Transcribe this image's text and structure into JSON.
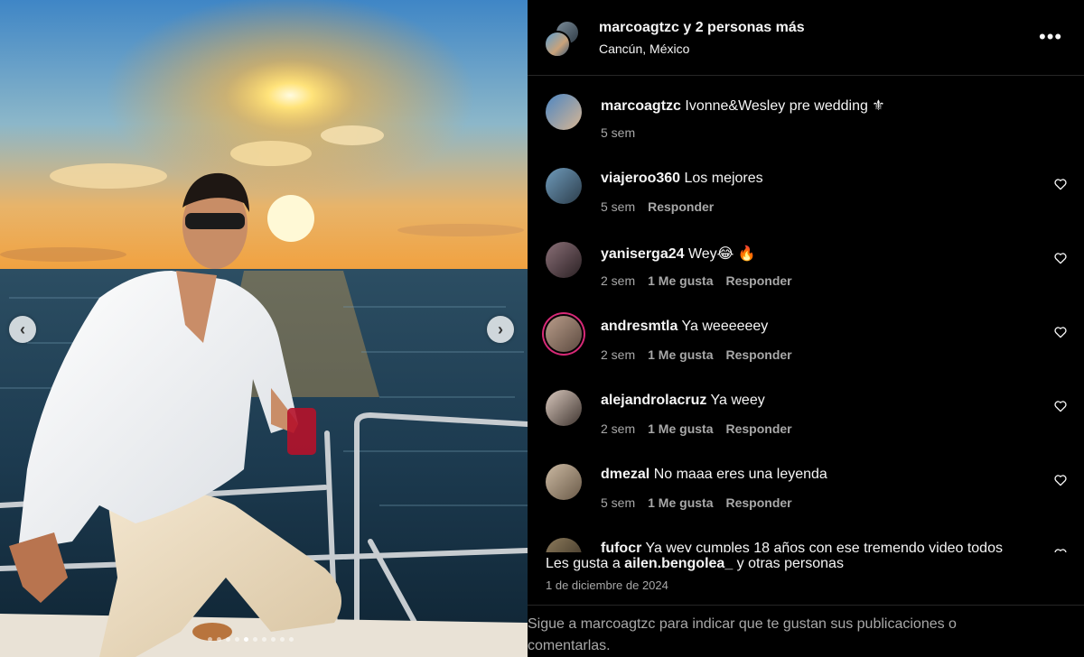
{
  "media": {
    "prev_icon": "chevron-left-icon",
    "next_icon": "chevron-right-icon",
    "prev_glyph": "‹",
    "next_glyph": "›",
    "dot_count": 10,
    "active_dot_index": 4
  },
  "header": {
    "title": "marcoagtzc y 2 personas más",
    "location": "Cancún, México",
    "more_glyph": "•••",
    "more_icon": "more-options-icon"
  },
  "comments": [
    {
      "user": "marcoagtzc",
      "text": " Ivonne&Wesley pre wedding ⚜",
      "time": "5 sem",
      "likes": "",
      "reply": "",
      "avatar_colors": [
        "#4d86c2",
        "#d8b693"
      ],
      "ring": false,
      "heart": false
    },
    {
      "user": "viajeroo360",
      "text": " Los mejores",
      "time": "5 sem",
      "likes": "",
      "reply": "Responder",
      "avatar_colors": [
        "#6f9bbb",
        "#2c3d4b"
      ],
      "ring": false,
      "heart": true
    },
    {
      "user": "yaniserga24",
      "text": " Wey😂 🔥",
      "time": "2 sem",
      "likes": "1 Me gusta",
      "reply": "Responder",
      "avatar_colors": [
        "#8a6f77",
        "#2b2124"
      ],
      "ring": false,
      "heart": true
    },
    {
      "user": "andresmtla",
      "text": " Ya weeeeeey",
      "time": "2 sem",
      "likes": "1 Me gusta",
      "reply": "Responder",
      "avatar_colors": [
        "#b99c8a",
        "#5c4b40"
      ],
      "ring": true,
      "heart": true
    },
    {
      "user": "alejandrolacruz",
      "text": " Ya weey",
      "time": "2 sem",
      "likes": "1 Me gusta",
      "reply": "Responder",
      "avatar_colors": [
        "#d9c8bd",
        "#3f3530"
      ],
      "ring": false,
      "heart": true
    },
    {
      "user": "dmezal",
      "text": " No maaa eres una leyenda",
      "time": "5 sem",
      "likes": "1 Me gusta",
      "reply": "Responder",
      "avatar_colors": [
        "#cbb9a2",
        "#6a5a48"
      ],
      "ring": false,
      "heart": true
    },
    {
      "user": "fufocr",
      "text": " Ya wey cumples 18 años con ese tremendo video todos",
      "time": "",
      "likes": "",
      "reply": "",
      "avatar_colors": [
        "#8d7b5c",
        "#332a1f"
      ],
      "ring": false,
      "heart": true
    }
  ],
  "footer": {
    "likes_prefix": "Les gusta a ",
    "likes_user": "ailen.bengolea_",
    "likes_suffix": " y otras personas",
    "date": "1 de diciembre de 2024",
    "follow_note": "Sigue a marcoagtzc para indicar que te gustan sus publicaciones o comentarlas."
  },
  "colors": {
    "background": "#000000",
    "text_primary": "#f5f5f5",
    "text_secondary": "#a8a8a8",
    "divider": "#262626"
  }
}
